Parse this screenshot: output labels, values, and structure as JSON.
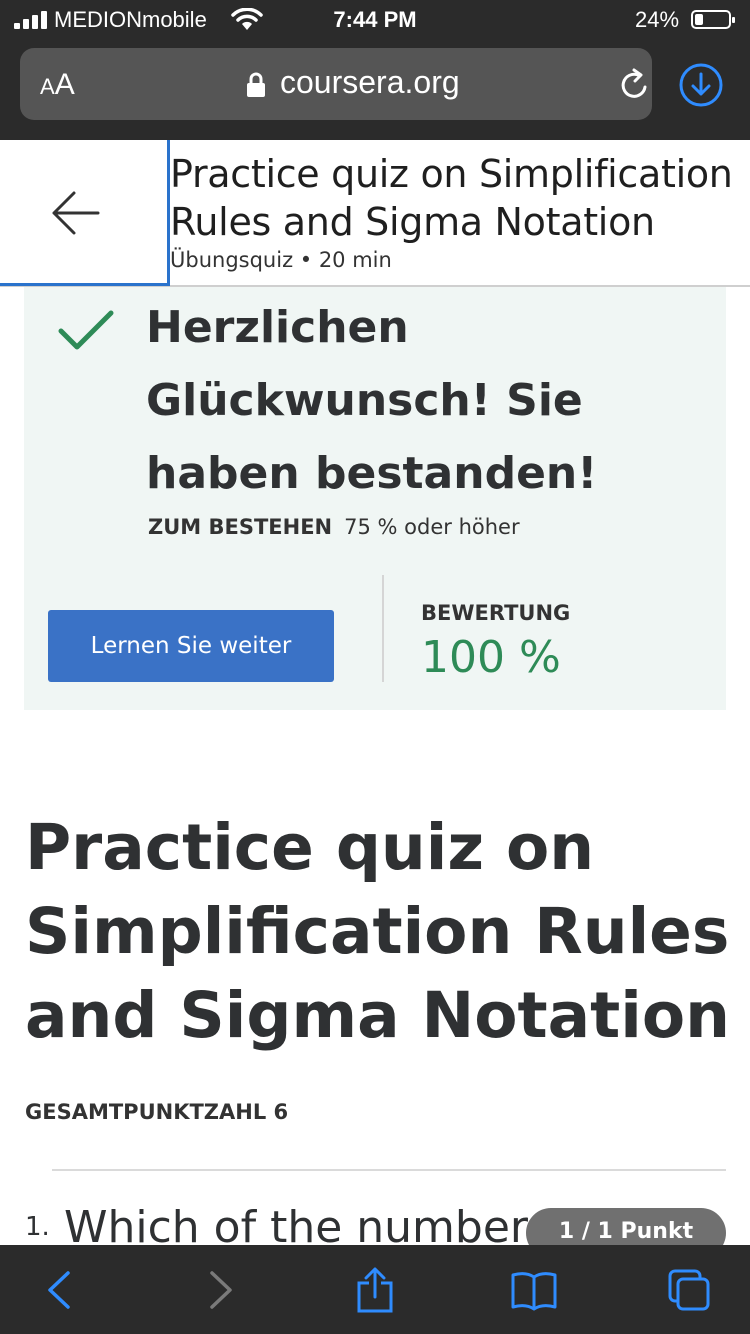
{
  "status_bar": {
    "carrier": "MEDIONmobile",
    "time": "7:44 PM",
    "battery_percent": "24%",
    "battery_level": 0.24
  },
  "browser": {
    "text_size_small": "A",
    "text_size_large": "A",
    "url": "coursera.org",
    "icons": [
      "lock-icon",
      "reload-icon",
      "download-icon",
      "back-icon",
      "forward-icon",
      "share-icon",
      "bookmarks-icon",
      "tabs-icon"
    ]
  },
  "header": {
    "title": "Practice quiz on Simplification Rules and Sigma Notation",
    "meta": "Übungsquiz • 20 min"
  },
  "result": {
    "headline": "Herzlichen Glückwunsch! Sie haben bestanden!",
    "pass_label": "ZUM BESTEHEN",
    "pass_value": "75 % oder höher",
    "continue_button": "Lernen Sie weiter",
    "grade_label": "BEWERTUNG",
    "grade_value": "100 %"
  },
  "main": {
    "title": "Practice quiz on Simplification Rules and Sigma Notation",
    "total_points": "GESAMTPUNKTZAHL 6",
    "questions": [
      {
        "number": "1.",
        "text": "Which of the numbers",
        "points": "1 / 1 Punkt"
      }
    ]
  },
  "colors": {
    "chrome": "#2b2b2b",
    "accent_blue": "#3a72c6",
    "success_green": "#2e8b57",
    "panel_bg": "#f0f6f4",
    "ios_blue": "#2f8cff"
  }
}
